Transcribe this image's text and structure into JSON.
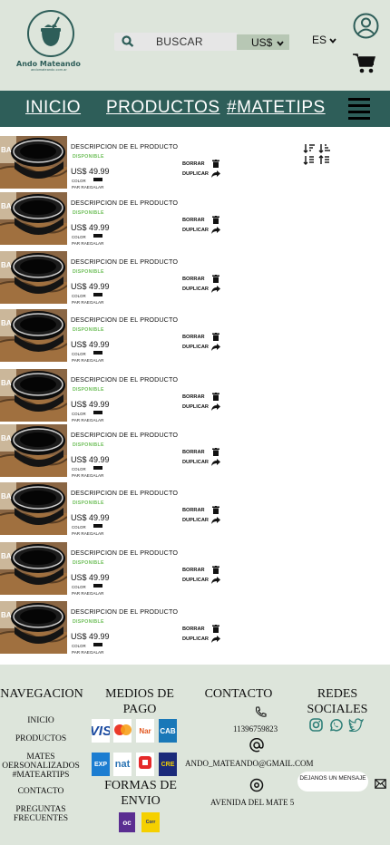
{
  "header": {
    "logo_name": "Ando Mateando",
    "logo_url": "andomateando.com.ar",
    "search_placeholder": "BUSCAR",
    "currency": "US$",
    "language": "ES"
  },
  "nav": {
    "items": [
      {
        "label": "INICIO"
      },
      {
        "label": "PRODUCTOS"
      },
      {
        "label": "#MATETIPS"
      }
    ]
  },
  "list": {
    "items": [
      {
        "description": "DESCRIPCION DE EL PRODUCTO",
        "status": "DISPONIBLE",
        "price": "US$ 49.99",
        "color_label": "COLOR",
        "color": "#111111",
        "gift_label": "PAR RAEGALAR",
        "delete_label": "BORRAR",
        "duplicate_label": "DUPLICAR"
      },
      {
        "description": "DESCRIPCION DE EL PRODUCTO",
        "status": "DISPONIBLE",
        "price": "US$ 49.99",
        "color_label": "COLOR",
        "color": "#111111",
        "gift_label": "PAR RAEGALAR",
        "delete_label": "BORRAR",
        "duplicate_label": "DUPLICAR"
      },
      {
        "description": "DESCRIPCION DE EL PRODUCTO",
        "status": "DISPONIBLE",
        "price": "US$ 49.99",
        "color_label": "COLOR",
        "color": "#111111",
        "gift_label": "PAR RAEGALAR",
        "delete_label": "BORRAR",
        "duplicate_label": "DUPLICAR"
      },
      {
        "description": "DESCRIPCION DE EL PRODUCTO",
        "status": "DISPONIBLE",
        "price": "US$ 49.99",
        "color_label": "COLOR",
        "color": "#111111",
        "gift_label": "PAR RAEGALAR",
        "delete_label": "BORRAR",
        "duplicate_label": "DUPLICAR"
      },
      {
        "description": "DESCRIPCION DE EL PRODUCTO",
        "status": "DISPONIBLE",
        "price": "US$ 49.99",
        "color_label": "COLOR",
        "color": "#111111",
        "gift_label": "PAR RAEGALAR",
        "delete_label": "BORRAR",
        "duplicate_label": "DUPLICAR"
      },
      {
        "description": "DESCRIPCION DE EL PRODUCTO",
        "status": "DISPONIBLE",
        "price": "US$ 49.99",
        "color_label": "COLOR",
        "color": "#111111",
        "gift_label": "PAR RAEGALAR",
        "delete_label": "BORRAR",
        "duplicate_label": "DUPLICAR"
      },
      {
        "description": "DESCRIPCION DE EL PRODUCTO",
        "status": "DISPONIBLE",
        "price": "US$ 49.99",
        "color_label": "COLOR",
        "color": "#111111",
        "gift_label": "PAR RAEGALAR",
        "delete_label": "BORRAR",
        "duplicate_label": "DUPLICAR"
      },
      {
        "description": "DESCRIPCION DE EL PRODUCTO",
        "status": "DISPONIBLE",
        "price": "US$ 49.99",
        "color_label": "COLOR",
        "color": "#111111",
        "gift_label": "PAR RAEGALAR",
        "delete_label": "BORRAR",
        "duplicate_label": "DUPLICAR"
      },
      {
        "description": "DESCRIPCION DE EL PRODUCTO",
        "status": "DISPONIBLE",
        "price": "US$ 49.99",
        "color_label": "COLOR",
        "color": "#111111",
        "gift_label": "PAR RAEGALAR",
        "delete_label": "BORRAR",
        "duplicate_label": "DUPLICAR"
      }
    ]
  },
  "footer": {
    "nav_title": "NAVEGACION",
    "nav_links": [
      "INICIO",
      "PRODUCTOS",
      "MATES OERSONALIZADOS #MATEARTIPS",
      "CONTACTO",
      "PREGUNTAS FRECUENTES"
    ],
    "payment_title": "MEDIOS DE PAGO",
    "shipping_title": "FORMAS DE ENVIO",
    "contact_title": "CONTACTO",
    "phone": "11396759823",
    "email": "ANDO_MATEANDO@GMAIL.COM",
    "address": "AVENIDA DEL MATE 5",
    "social_title": "REDES SOCIALES",
    "message_button": "DEJANOS UN MENSAJE"
  },
  "colors": {
    "header_bg": "#dde5db",
    "nav_bg": "#2e5e59",
    "available_green": "#6fbf5a",
    "social_teal": "#2e7f78",
    "currency_bg": "#b7c7b4"
  },
  "icons": [
    "search-icon",
    "chevron-down-icon",
    "user-icon",
    "cart-icon",
    "menu-icon",
    "trash-icon",
    "share-icon",
    "sort-icon",
    "phone-icon",
    "at-icon",
    "location-icon",
    "instagram-icon",
    "whatsapp-icon",
    "twitter-icon",
    "envelope-icon"
  ]
}
